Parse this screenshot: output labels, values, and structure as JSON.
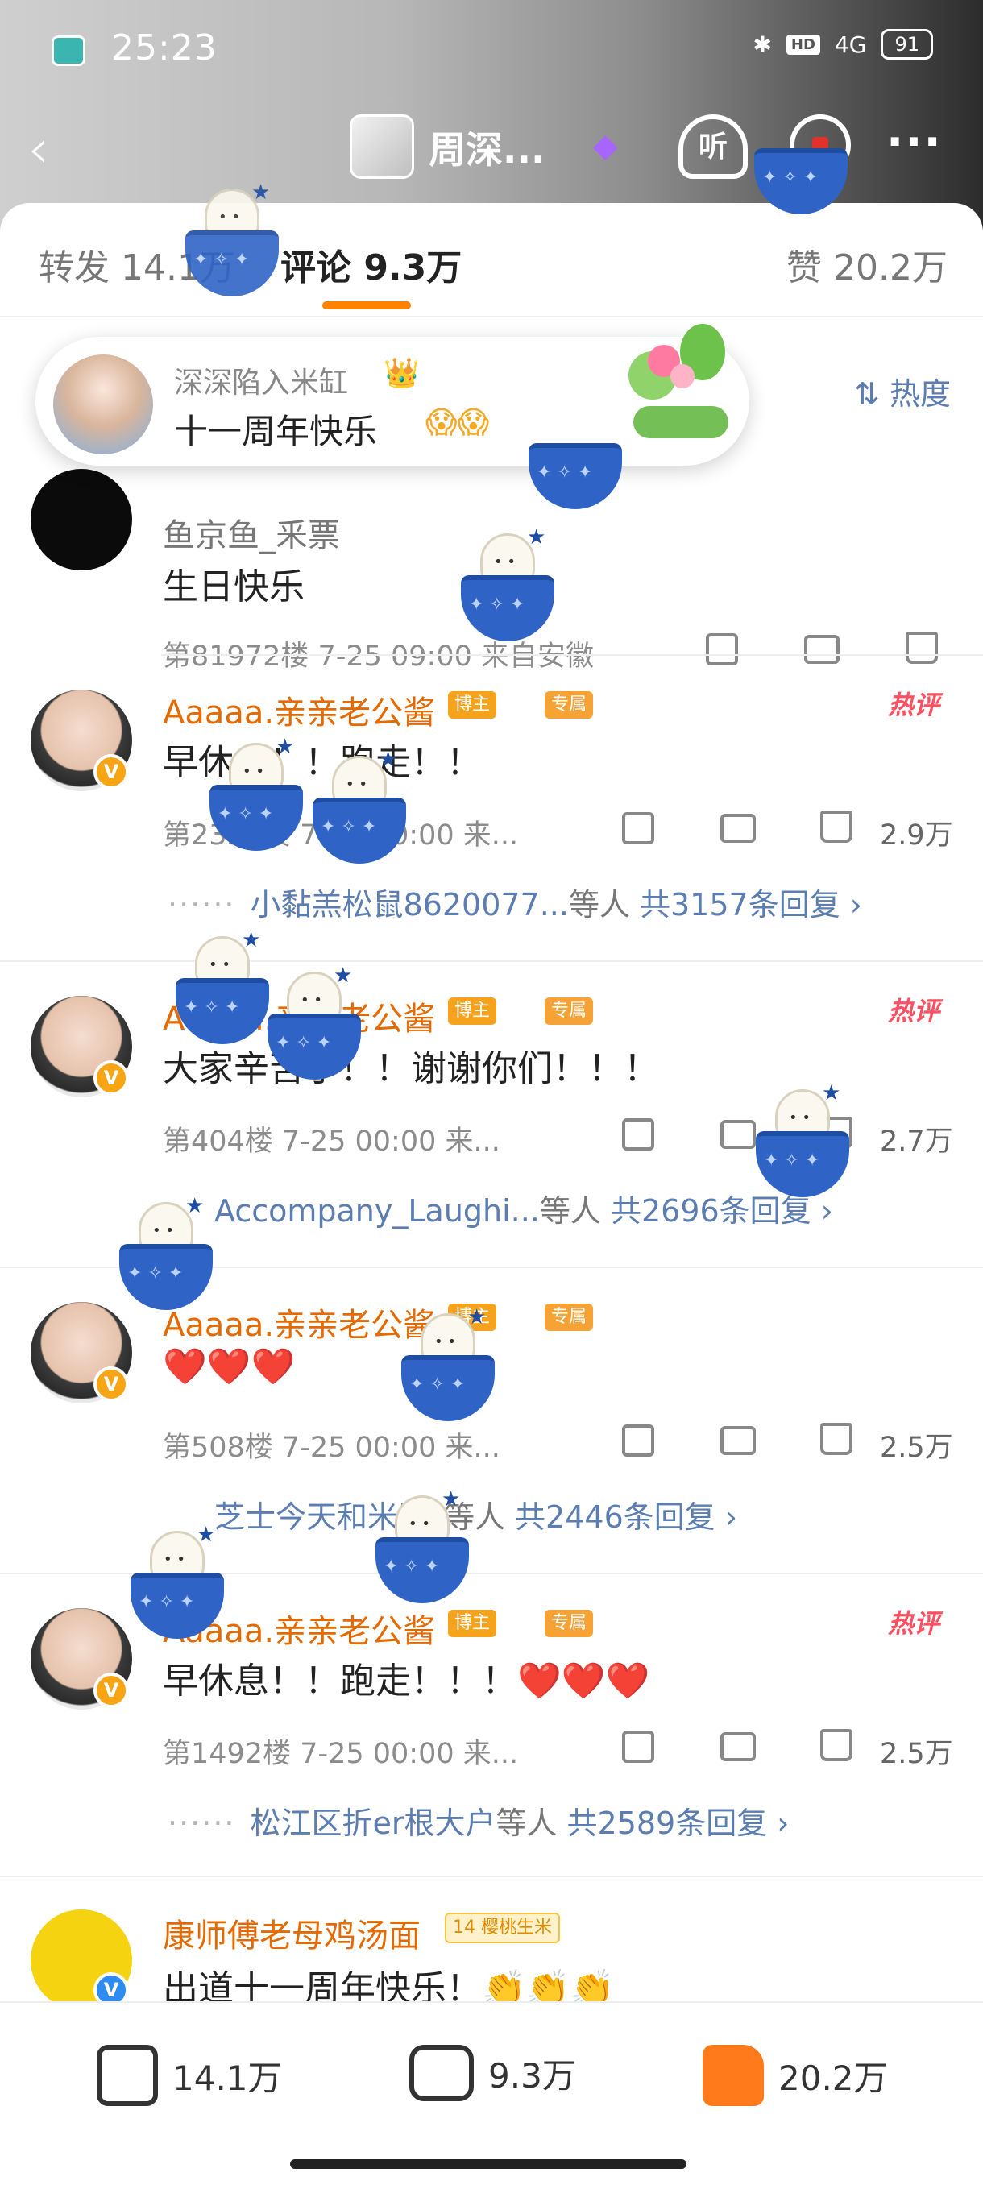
{
  "status_bar": {
    "time": "25:23",
    "network": "4G",
    "hd_label": "HD",
    "battery": "91",
    "icons": [
      "app-icon",
      "bluetooth-icon",
      "hd-icon",
      "signal-icon",
      "battery-icon"
    ]
  },
  "nav": {
    "title": "周深...",
    "listen_label": "听",
    "icons": [
      "back-icon",
      "gem-icon",
      "listen-icon",
      "search-icon",
      "more-icon"
    ]
  },
  "tabs": {
    "repost": "转发 14.1万",
    "comment": "评论 9.3万",
    "like": "赞 20.2万"
  },
  "popup": {
    "user": "深深陷入米缸",
    "text": "十一周年快乐",
    "faces": "😱😱",
    "crown": "👑"
  },
  "sort_label": "热度",
  "comments": [
    {
      "user": "鱼京鱼_釆票",
      "text": "生日快乐",
      "meta": "第81972楼 7-25 09:00 来自安徽",
      "likes": ""
    },
    {
      "user": "Aaaaa.亲亲老公酱",
      "badge_blogger": "博主",
      "badge_special": "专属",
      "hot": "热评",
      "text": "早休息！！跑走！！",
      "meta": "第2355楼 7-25 00:00 来...",
      "likes": "2.9万",
      "reply_users": "小黏羔松鼠8620077...",
      "reply_suffix": "等人",
      "reply_count": "共3157条回复 ›"
    },
    {
      "user": "Aaaaa.亲亲老公酱",
      "badge_blogger": "博主",
      "badge_special": "专属",
      "hot": "热评",
      "text": "大家辛苦了！！谢谢你们！！！",
      "meta": "第404楼 7-25 00:00 来...",
      "likes": "2.7万",
      "reply_users": "Accompany_Laughi...",
      "reply_suffix": "等人",
      "reply_count": "共2696条回复 ›"
    },
    {
      "user": "Aaaaa.亲亲老公酱",
      "badge_blogger": "博主",
      "badge_special": "专属",
      "text": "❤️❤️❤️",
      "meta": "第508楼 7-25 00:00 来...",
      "likes": "2.5万",
      "reply_users": "芝士今天和米助_",
      "reply_suffix": "等人",
      "reply_count": "共2446条回复 ›"
    },
    {
      "user": "Aaaaa.亲亲老公酱",
      "badge_blogger": "博主",
      "badge_special": "专属",
      "hot": "热评",
      "text": "早休息！！跑走！！！",
      "text_hearts": "❤️❤️❤️",
      "meta": "第1492楼 7-25 00:00 来...",
      "likes": "2.5万",
      "reply_users": "松江区折er根大户",
      "reply_suffix": "等人",
      "reply_count": "共2589条回复 ›"
    },
    {
      "user": "康师傅老母鸡汤面",
      "badge_level": "14",
      "badge_level_text": "樱桃生米",
      "text": "出道十一周年快乐！👏👏👏"
    }
  ],
  "bottom_bar": {
    "share": "14.1万",
    "comment": "9.3万",
    "like": "20.2万"
  },
  "colors": {
    "accent": "#ff8200",
    "link": "#5b7db1",
    "hot": "#ff4f60",
    "vip_name": "#e46a00"
  }
}
